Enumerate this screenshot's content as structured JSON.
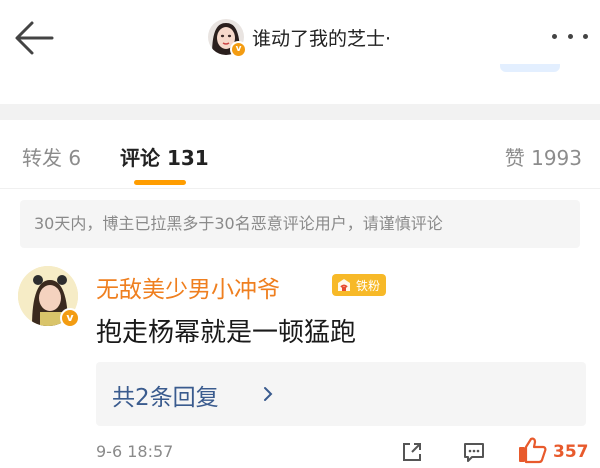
{
  "header": {
    "back_icon": "arrow-left-icon",
    "title": "谁动了我的芝士·",
    "more_icon": "more-dots-icon",
    "verified_badge": "v"
  },
  "tabs": [
    {
      "label": "转发 6",
      "active": false
    },
    {
      "label": "评论 131",
      "active": true
    },
    {
      "label": "赞 1993",
      "active": false
    }
  ],
  "notice": "30天内，博主已拉黑多于30名恶意评论用户，请谨慎评论",
  "comment": {
    "username": "无敌美少男小冲爷",
    "fan_badge": "铁粉",
    "verified_badge": "v",
    "text": "抱走杨幂就是一顿猛跑",
    "replies_label": "共2条回复",
    "replies_chevron_icon": "chevron-right-icon",
    "time": "9-6 18:57",
    "share_icon": "share-icon",
    "reply_icon": "comment-icon",
    "like_icon": "thumbs-up-icon",
    "like_count": "357"
  },
  "colors": {
    "accent_orange": "#ff9d00",
    "username_orange": "#ef7f1f",
    "link_blue": "#3a5b8e",
    "like_red": "#e85a2c",
    "badge_gold": "#f7b928"
  }
}
